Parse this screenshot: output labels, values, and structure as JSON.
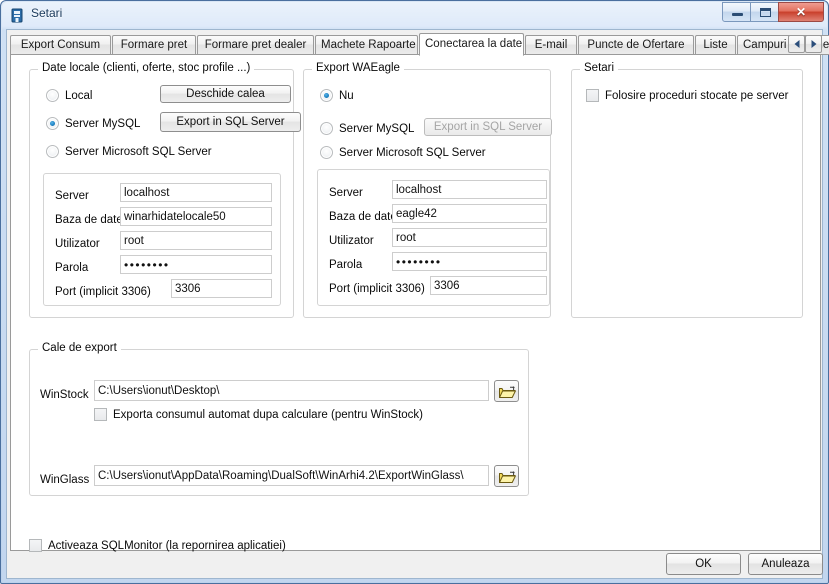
{
  "window": {
    "title": "Setari",
    "icon": "app-building-icon",
    "controls": {
      "minimize": "minimize-icon",
      "maximize": "maximize-icon",
      "close": "✕"
    }
  },
  "tabs": [
    {
      "label": "Export Consum",
      "selected": false
    },
    {
      "label": "Formare pret",
      "selected": false
    },
    {
      "label": "Formare pret dealer",
      "selected": false
    },
    {
      "label": "Machete Rapoarte",
      "selected": false
    },
    {
      "label": "Conectarea la date",
      "selected": true
    },
    {
      "label": "E-mail",
      "selected": false
    },
    {
      "label": "Puncte de Ofertare",
      "selected": false
    },
    {
      "label": "Liste",
      "selected": false
    },
    {
      "label": "Campuri suplimentare",
      "selected": false
    }
  ],
  "tab_scroll": {
    "left": "◄",
    "right": "►"
  },
  "local_group": {
    "legend": "Date locale (clienti, oferte, stoc profile ...)",
    "radios": [
      {
        "label": "Local",
        "checked": false
      },
      {
        "label": "Server MySQL",
        "checked": true
      },
      {
        "label": "Server Microsoft SQL Server",
        "checked": false
      }
    ],
    "open_path_button": "Deschide calea",
    "export_button": "Export in SQL Server",
    "export_button_disabled": false,
    "fields": [
      {
        "label": "Server",
        "value": "localhost",
        "password": false
      },
      {
        "label": "Baza de date",
        "value": "winarhidatelocale50",
        "password": false
      },
      {
        "label": "Utilizator",
        "value": "root",
        "password": false
      },
      {
        "label": "Parola",
        "value": "••••••••",
        "password": true
      },
      {
        "label": "Port (implicit 3306)",
        "value": "3306",
        "password": false
      }
    ]
  },
  "eagle_group": {
    "legend": "Export WAEagle",
    "radios": [
      {
        "label": "Nu",
        "checked": true
      },
      {
        "label": "Server MySQL",
        "checked": false
      },
      {
        "label": "Server Microsoft SQL Server",
        "checked": false
      }
    ],
    "export_button": "Export in SQL Server",
    "export_button_disabled": true,
    "fields": [
      {
        "label": "Server",
        "value": "localhost",
        "password": false
      },
      {
        "label": "Baza de date",
        "value": "eagle42",
        "password": false
      },
      {
        "label": "Utilizator",
        "value": "root",
        "password": false
      },
      {
        "label": "Parola",
        "value": "••••••••",
        "password": true
      },
      {
        "label": "Port (implicit 3306)",
        "value": "3306",
        "password": false
      }
    ]
  },
  "settings_group": {
    "legend": "Setari",
    "checkbox": {
      "label": "Folosire proceduri stocate pe server",
      "checked": false
    }
  },
  "export_path_group": {
    "legend": "Cale de export",
    "winstock": {
      "label": "WinStock",
      "value": "C:\\Users\\ionut\\Desktop\\",
      "browse_icon": "folder-open-icon"
    },
    "auto_export_checkbox": {
      "label": "Exporta consumul automat dupa calculare (pentru WinStock)",
      "checked": false
    },
    "winglass": {
      "label": "WinGlass",
      "value": "C:\\Users\\ionut\\AppData\\Roaming\\DualSoft\\WinArhi4.2\\ExportWinGlass\\",
      "browse_icon": "folder-open-icon"
    }
  },
  "sqlmonitor_checkbox": {
    "label": "Activeaza SQLMonitor (la repornirea aplicatiei)",
    "checked": false
  },
  "footer": {
    "ok": "OK",
    "cancel": "Anuleaza"
  },
  "colors": {
    "titlebar_text": "#1b3a5c",
    "close_button": "#c93f2b",
    "radio_dot": "#1a7fc1",
    "folder_icon": "#e8c920",
    "tab_page_bg": "#ffffff"
  }
}
